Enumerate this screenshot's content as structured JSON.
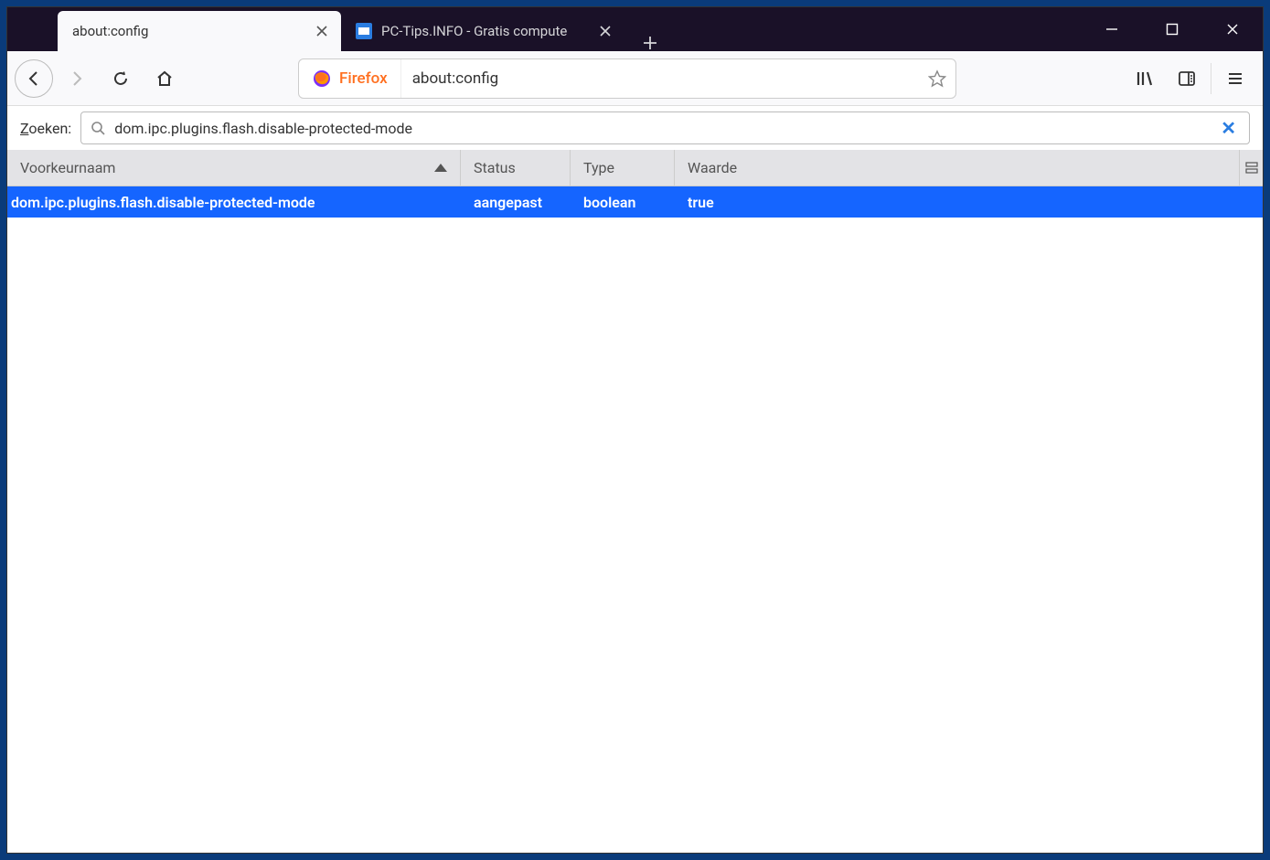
{
  "tabs": [
    {
      "label": "about:config",
      "active": true
    },
    {
      "label": "PC-Tips.INFO - Gratis compute",
      "active": false
    }
  ],
  "urlbar": {
    "brand": "Firefox",
    "url": "about:config"
  },
  "search": {
    "label_prefix": "Z",
    "label_rest": "oeken:",
    "value": "dom.ipc.plugins.flash.disable-protected-mode"
  },
  "columns": {
    "name": "Voorkeurnaam",
    "status": "Status",
    "type": "Type",
    "value": "Waarde"
  },
  "rows": [
    {
      "name": "dom.ipc.plugins.flash.disable-protected-mode",
      "status": "aangepast",
      "type": "boolean",
      "value": "true"
    }
  ]
}
